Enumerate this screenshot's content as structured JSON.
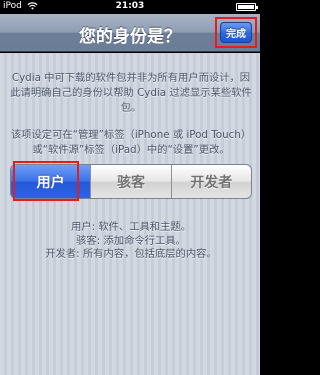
{
  "status_bar": {
    "carrier": "iPod",
    "time": "21:03"
  },
  "nav": {
    "title": "您的身份是？",
    "done_label": "完成"
  },
  "intro": {
    "paragraph1": "Cydia 中可下载的软件包并非为所有用户而设计，因此请明确自己的身份以帮助 Cydia 过滤显示某些软件包。",
    "paragraph2": "该项设定可在“管理”标签（iPhone 或 iPod Touch）或“软件源”标签（iPad）中的“设置”更改。"
  },
  "segments": [
    {
      "label": "用户",
      "selected": true
    },
    {
      "label": "骇客",
      "selected": false
    },
    {
      "label": "开发者",
      "selected": false
    }
  ],
  "roles": {
    "user": "用户: 软件、工具和主题。",
    "hacker": "骇客: 添加命令行工具。",
    "developer": "开发者: 所有内容，包括底层的内容。"
  },
  "colors": {
    "accent_blue": "#2d69e3",
    "highlight_red": "#e02020",
    "nav_bar": "#8e9db2",
    "background": "#c6cdd8"
  }
}
